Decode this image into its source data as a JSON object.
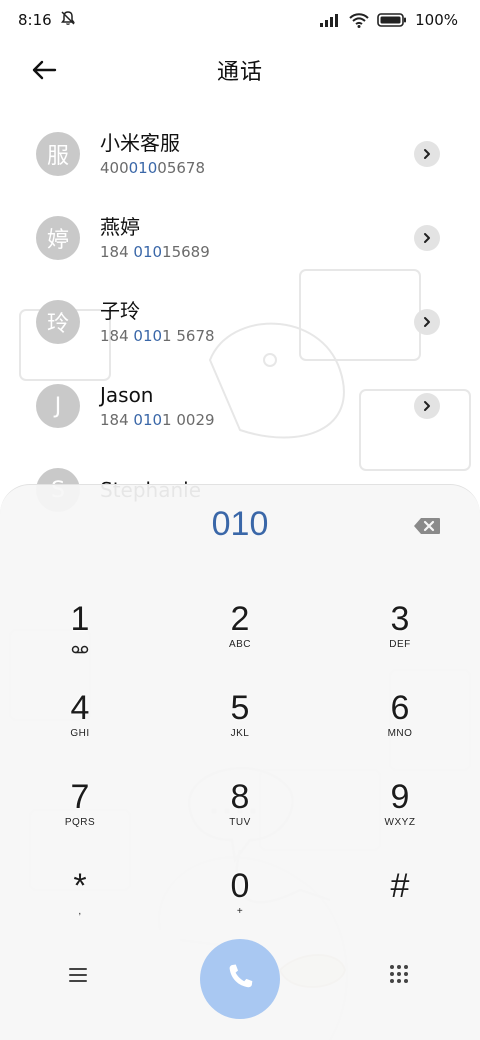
{
  "status_bar": {
    "time": "8:16",
    "battery": "100%"
  },
  "header": {
    "title": "通话"
  },
  "contacts": [
    {
      "avatar": "服",
      "name": "小米客服",
      "number_pre": "400",
      "number_hl": "010",
      "number_post": "05678"
    },
    {
      "avatar": "婷",
      "name": "燕婷",
      "number_pre": "184 ",
      "number_hl": "010",
      "number_post": "15689"
    },
    {
      "avatar": "玲",
      "name": "子玲",
      "number_pre": "184 ",
      "number_hl": "010",
      "number_post": "1 5678"
    },
    {
      "avatar": "J",
      "name": "Jason",
      "number_pre": "184 ",
      "number_hl": "010",
      "number_post": "1 0029"
    },
    {
      "avatar": "S",
      "name": "Stephanie",
      "number_pre": "",
      "number_hl": "",
      "number_post": ""
    }
  ],
  "dialer": {
    "number": "010",
    "keys": [
      {
        "digit": "1",
        "letters": ""
      },
      {
        "digit": "2",
        "letters": "ABC"
      },
      {
        "digit": "3",
        "letters": "DEF"
      },
      {
        "digit": "4",
        "letters": "GHI"
      },
      {
        "digit": "5",
        "letters": "JKL"
      },
      {
        "digit": "6",
        "letters": "MNO"
      },
      {
        "digit": "7",
        "letters": "PQRS"
      },
      {
        "digit": "8",
        "letters": "TUV"
      },
      {
        "digit": "9",
        "letters": "WXYZ"
      },
      {
        "digit": "*",
        "letters": ","
      },
      {
        "digit": "0",
        "letters": "+"
      },
      {
        "digit": "#",
        "letters": ""
      }
    ]
  },
  "icons": {
    "back": "arrow-left-icon",
    "mute": "bell-off-icon",
    "signal": "signal-icon",
    "wifi": "wifi-icon",
    "battery": "battery-icon",
    "chevron": "chevron-right-icon",
    "backspace": "backspace-icon",
    "voicemail": "voicemail-icon",
    "menu": "menu-icon",
    "call": "phone-icon",
    "dialpad": "dialpad-icon"
  },
  "colors": {
    "accent": "#3a67a8",
    "call_button": "#a9c8f2",
    "avatar": "#c9c9c9"
  }
}
